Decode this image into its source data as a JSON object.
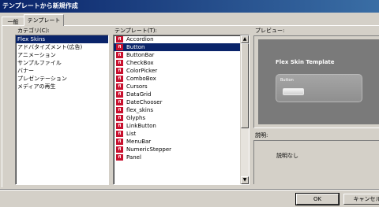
{
  "window": {
    "title": "テンプレートから新規作成"
  },
  "tabs": [
    {
      "label": "一般"
    },
    {
      "label": "テンプレート"
    }
  ],
  "categories": {
    "label": "カテゴリ(C):",
    "items": [
      "Flex Skins",
      "アドバタイズメント(広告)",
      "アニメーション",
      "サンプルファイル",
      "バナー",
      "プレゼンテーション",
      "メディアの再生"
    ],
    "selected": "Flex Skins"
  },
  "templates": {
    "label": "テンプレート(T):",
    "items": [
      "Accordion",
      "Button",
      "ButtonBar",
      "CheckBox",
      "ColorPicker",
      "ComboBox",
      "Cursors",
      "DataGrid",
      "DateChooser",
      "flex_skins",
      "Glyphs",
      "LinkButton",
      "List",
      "MenuBar",
      "NumericStepper",
      "Panel"
    ],
    "selected": "Button",
    "icon": "flash-file-icon"
  },
  "preview": {
    "label": "プレビュー:",
    "title": "Flex Skin Template",
    "button_label": "Button"
  },
  "description": {
    "label": "説明:",
    "text": "説明なし"
  },
  "footer": {
    "ok_label": "OK",
    "cancel_label": "キャンセル"
  },
  "colors": {
    "title_bar": "#0a246a",
    "selection": "#0a246a",
    "icon_red": "#c8102e"
  }
}
